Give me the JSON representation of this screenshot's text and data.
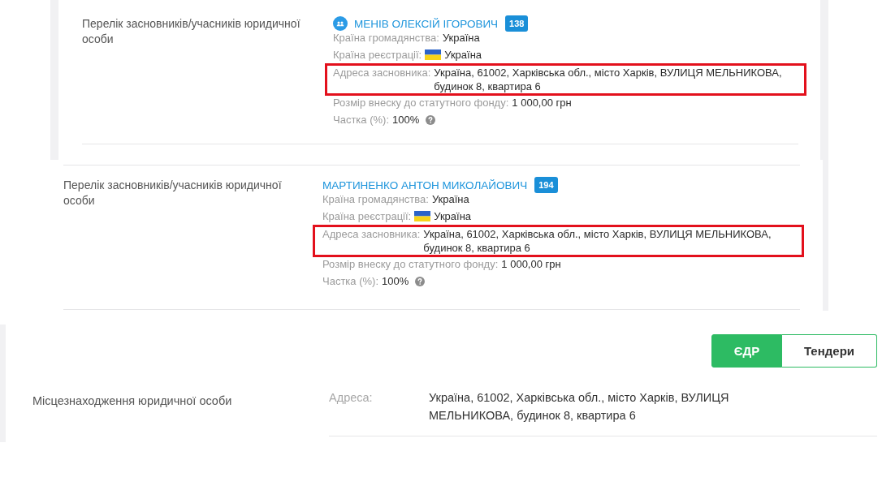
{
  "panels": [
    {
      "label": "Перелік засновників/учасників юридичної особи",
      "founder": {
        "name": "МЕНІВ ОЛЕКСІЙ ІГОРОВИЧ",
        "has_icon": true,
        "count": "138",
        "fields": [
          {
            "kind": "text",
            "label": "Країна громадянства:",
            "value": "Україна",
            "highlighted": false
          },
          {
            "kind": "flag",
            "label": "Країна реєстрації:",
            "value": "Україна",
            "highlighted": false
          },
          {
            "kind": "text",
            "label": "Адреса засновника:",
            "value": "Україна, 61002, Харківська обл., місто Харків, ВУЛИЦЯ МЕЛЬНИКОВА, будинок 8, квартира 6",
            "highlighted": true
          },
          {
            "kind": "text",
            "label": "Розмір внеску до статутного фонду:",
            "value": "1 000,00 грн",
            "highlighted": false
          },
          {
            "kind": "help",
            "label": "Частка (%):",
            "value": "100%",
            "highlighted": false
          }
        ]
      }
    },
    {
      "label": "Перелік засновників/учасників юридичної особи",
      "founder": {
        "name": "МАРТИНЕНКО АНТОН МИКОЛАЙОВИЧ",
        "has_icon": false,
        "count": "194",
        "fields": [
          {
            "kind": "text",
            "label": "Країна громадянства:",
            "value": "Україна",
            "highlighted": false
          },
          {
            "kind": "flag",
            "label": "Країна реєстрації:",
            "value": "Україна",
            "highlighted": false
          },
          {
            "kind": "text",
            "label": "Адреса засновника:",
            "value": "Україна, 61002, Харківська обл., місто Харків, ВУЛИЦЯ МЕЛЬНИКОВА, будинок 8, квартира 6",
            "highlighted": true
          },
          {
            "kind": "text",
            "label": "Розмір внеску до статутного фонду:",
            "value": "1 000,00 грн",
            "highlighted": false
          },
          {
            "kind": "help",
            "label": "Частка (%):",
            "value": "100%",
            "highlighted": false
          }
        ]
      }
    }
  ],
  "location": {
    "tabs": [
      {
        "label": "ЄДР",
        "selected": true
      },
      {
        "label": "Тендери",
        "selected": false
      }
    ],
    "label": "Місцезнаходження юридичної особи",
    "field_label": "Адреса:",
    "value": "Україна, 61002, Харківська обл., місто Харків, ВУЛИЦЯ МЕЛЬНИКОВА, будинок 8, квартира 6"
  }
}
